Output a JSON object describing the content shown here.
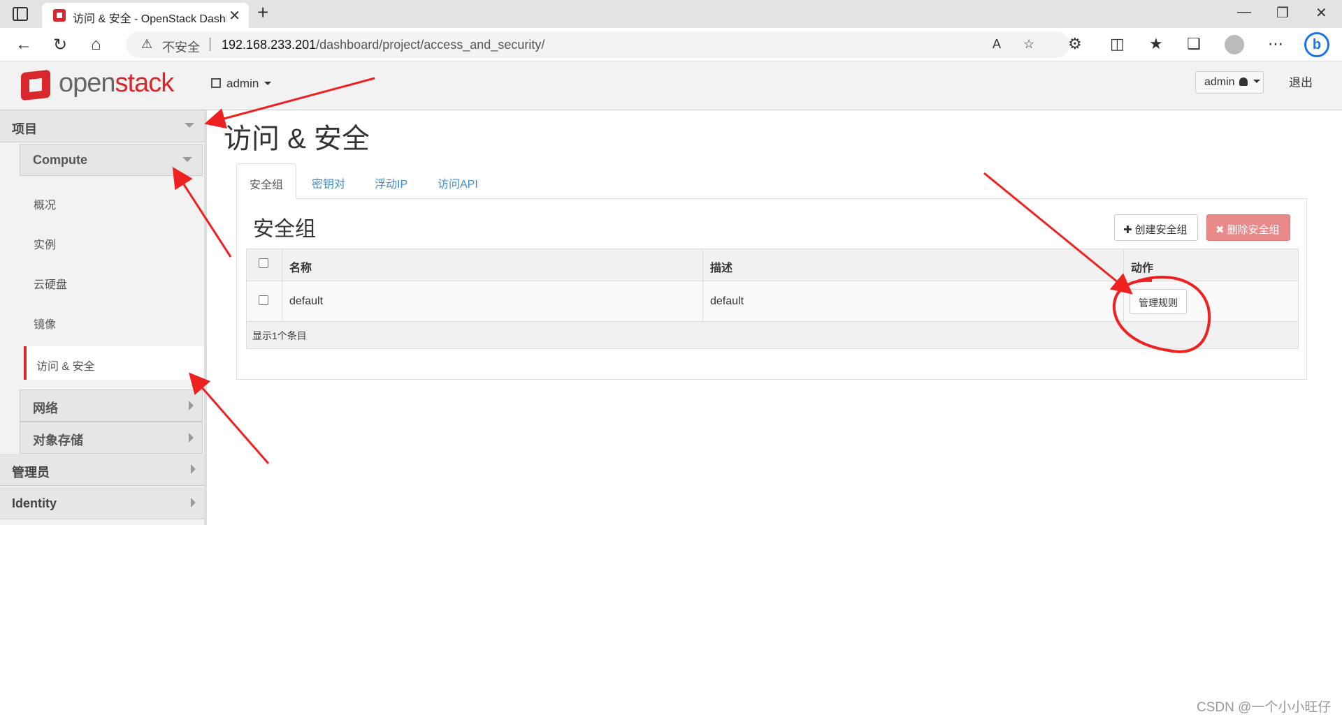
{
  "browser": {
    "tab_title": "访问 & 安全 - OpenStack Dashboard",
    "new_tab": "+",
    "insecure_label": "不安全",
    "url_host": "192.168.233.201",
    "url_path": "/dashboard/project/access_and_security/",
    "bing_label": "b"
  },
  "header": {
    "logo_brand": "open",
    "logo_brand2": "stack",
    "project": "admin",
    "user": "admin",
    "signout": "退出"
  },
  "sidebar": {
    "project": "项目",
    "compute": "Compute",
    "items": [
      "概况",
      "实例",
      "云硬盘",
      "镜像"
    ],
    "active_item": "访问 & 安全",
    "network": "网络",
    "object_storage": "对象存储",
    "admin": "管理员",
    "identity": "Identity"
  },
  "main": {
    "page_title": "访问 & 安全",
    "tabs": [
      "安全组",
      "密钥对",
      "浮动IP",
      "访问API"
    ],
    "section_title": "安全组",
    "create_button": "创建安全组",
    "delete_button": "删除安全组",
    "columns": [
      "名称",
      "描述",
      "动作"
    ],
    "rows": [
      {
        "name": "default",
        "description": "default",
        "action": "管理规则"
      }
    ],
    "footer": "显示1个条目"
  },
  "watermark": "CSDN @一个小小旺仔",
  "colors": {
    "accent": "#d9272e",
    "link": "#428bca",
    "annotation": "#ee2020"
  }
}
